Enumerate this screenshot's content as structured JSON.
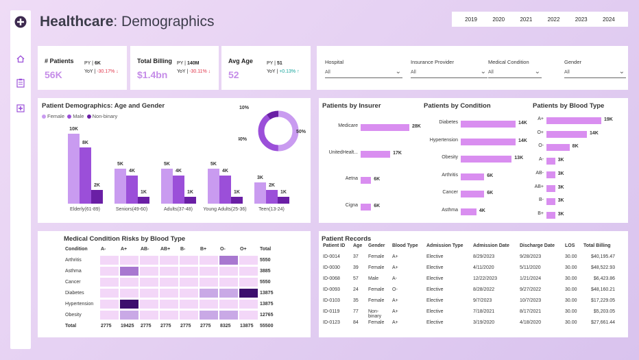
{
  "title": {
    "strong": "Healthcare",
    "rest": ": Demographics"
  },
  "years": [
    "2019",
    "2020",
    "2021",
    "2022",
    "2023",
    "2024"
  ],
  "kpis": [
    {
      "label": "# Patients",
      "value": "56K",
      "py_label": "PY |",
      "py": "6K",
      "yoy_label": "YoY |",
      "yoy": "-30.17% ↓",
      "yoy_dir": "neg"
    },
    {
      "label": "Total Billing",
      "value": "$1.4bn",
      "py_label": "PY |",
      "py": "140M",
      "yoy_label": "YoY |",
      "yoy": "-30.11% ↓",
      "yoy_dir": "neg"
    },
    {
      "label": "Avg Age",
      "value": "52",
      "py_label": "PY |",
      "py": "51",
      "yoy_label": "YoY |",
      "yoy": "+0.13% ↑",
      "yoy_dir": "pos"
    }
  ],
  "filters": [
    {
      "label": "Hospital",
      "value": "All"
    },
    {
      "label": "Insurance Provider",
      "value": "All"
    },
    {
      "label": "Medical Condition",
      "value": "All"
    },
    {
      "label": "Gender",
      "value": "All"
    }
  ],
  "demographics": {
    "title": "Patient Demographics: Age and Gender",
    "legend": [
      "Female",
      "Male",
      "Non-binary"
    ],
    "colors": [
      "#c99bf0",
      "#9b4fd9",
      "#6a1fa5"
    ],
    "groups": [
      {
        "name": "Elderly(61-89)",
        "values": [
          10,
          8,
          2
        ],
        "labels": [
          "10K",
          "8K",
          "2K"
        ]
      },
      {
        "name": "Seniors(49-60)",
        "values": [
          5,
          4,
          1
        ],
        "labels": [
          "5K",
          "4K",
          "1K"
        ]
      },
      {
        "name": "Adults(37-48)",
        "values": [
          5,
          4,
          1
        ],
        "labels": [
          "5K",
          "4K",
          "1K"
        ]
      },
      {
        "name": "Young Adults(25-36)",
        "values": [
          5,
          4,
          1
        ],
        "labels": [
          "5K",
          "4K",
          "1K"
        ]
      },
      {
        "name": "Teen(13-24)",
        "values": [
          3,
          2,
          1
        ],
        "labels": [
          "3K",
          "2K",
          "1K"
        ]
      }
    ],
    "donut": [
      {
        "label": "50%",
        "value": 50
      },
      {
        "label": "40%",
        "value": 40
      },
      {
        "label": "10%",
        "value": 10
      }
    ]
  },
  "insurer": {
    "title": "Patients by Insurer",
    "items": [
      {
        "name": "Medicare",
        "value": 28,
        "label": "28K"
      },
      {
        "name": "UnitedHealt...",
        "value": 17,
        "label": "17K"
      },
      {
        "name": "Aetna",
        "value": 6,
        "label": "6K"
      },
      {
        "name": "Cigna",
        "value": 6,
        "label": "6K"
      }
    ]
  },
  "condition": {
    "title": "Patients by Condition",
    "items": [
      {
        "name": "Diabetes",
        "value": 14,
        "label": "14K"
      },
      {
        "name": "Hypertension",
        "value": 14,
        "label": "14K"
      },
      {
        "name": "Obesity",
        "value": 13,
        "label": "13K"
      },
      {
        "name": "Arthritis",
        "value": 6,
        "label": "6K"
      },
      {
        "name": "Cancer",
        "value": 6,
        "label": "6K"
      },
      {
        "name": "Asthma",
        "value": 4,
        "label": "4K"
      }
    ]
  },
  "blood": {
    "title": "Patients by Blood Type",
    "items": [
      {
        "name": "A+",
        "value": 19,
        "label": "19K"
      },
      {
        "name": "O+",
        "value": 14,
        "label": "14K"
      },
      {
        "name": "O-",
        "value": 8,
        "label": "8K"
      },
      {
        "name": "A-",
        "value": 3,
        "label": "3K"
      },
      {
        "name": "AB-",
        "value": 3,
        "label": "3K"
      },
      {
        "name": "AB+",
        "value": 3,
        "label": "3K"
      },
      {
        "name": "B-",
        "value": 3,
        "label": "3K"
      },
      {
        "name": "B+",
        "value": 3,
        "label": "3K"
      }
    ]
  },
  "risk": {
    "title": "Medical Condition Risks by Blood Type",
    "headers": [
      "Condition",
      "A-",
      "A+",
      "AB-",
      "AB+",
      "B-",
      "B+",
      "O-",
      "O+",
      "Total"
    ],
    "rows": [
      {
        "name": "Arthritis",
        "cells": [
          1,
          1,
          1,
          1,
          1,
          1,
          3,
          1
        ],
        "total": "5550"
      },
      {
        "name": "Asthma",
        "cells": [
          1,
          3,
          1,
          1,
          1,
          1,
          1,
          1
        ],
        "total": "3885"
      },
      {
        "name": "Cancer",
        "cells": [
          1,
          1,
          1,
          1,
          1,
          1,
          1,
          1
        ],
        "total": "5550"
      },
      {
        "name": "Diabetes",
        "cells": [
          1,
          1,
          1,
          1,
          1,
          2,
          2,
          4
        ],
        "total": "13875"
      },
      {
        "name": "Hypertension",
        "cells": [
          1,
          4,
          1,
          1,
          1,
          1,
          1,
          1
        ],
        "total": "13875"
      },
      {
        "name": "Obesity",
        "cells": [
          1,
          2,
          1,
          1,
          1,
          2,
          2,
          1
        ],
        "total": "12765"
      }
    ],
    "total_row": [
      "Total",
      "2775",
      "19425",
      "2775",
      "2775",
      "2775",
      "2775",
      "8325",
      "13875",
      "55500"
    ]
  },
  "records": {
    "title": "Patient Records",
    "headers": [
      "Patient ID",
      "Age",
      "Gender",
      "Blood Type",
      "Admission Type",
      "Admission Date",
      "Discharge Date",
      "LOS",
      "Total Billing"
    ],
    "rows": [
      [
        "ID-0014",
        "37",
        "Female",
        "A+",
        "Elective",
        "8/29/2023",
        "9/28/2023",
        "30.00",
        "$40,195.47"
      ],
      [
        "ID-0030",
        "39",
        "Female",
        "A+",
        "Elective",
        "4/11/2020",
        "5/11/2020",
        "30.00",
        "$48,522.93"
      ],
      [
        "ID-0068",
        "57",
        "Male",
        "A-",
        "Elective",
        "12/22/2023",
        "1/21/2024",
        "30.00",
        "$6,423.86"
      ],
      [
        "ID-0093",
        "24",
        "Female",
        "O-",
        "Elective",
        "8/28/2022",
        "9/27/2022",
        "30.00",
        "$48,160.21"
      ],
      [
        "ID-0103",
        "35",
        "Female",
        "A+",
        "Elective",
        "9/7/2023",
        "10/7/2023",
        "30.00",
        "$17,229.05"
      ],
      [
        "ID-0119",
        "77",
        "Non-binary",
        "A+",
        "Elective",
        "7/18/2021",
        "8/17/2021",
        "30.00",
        "$5,203.05"
      ],
      [
        "ID-0123",
        "84",
        "Female",
        "A+",
        "Elective",
        "3/19/2020",
        "4/18/2020",
        "30.00",
        "$27,661.44"
      ]
    ]
  }
}
